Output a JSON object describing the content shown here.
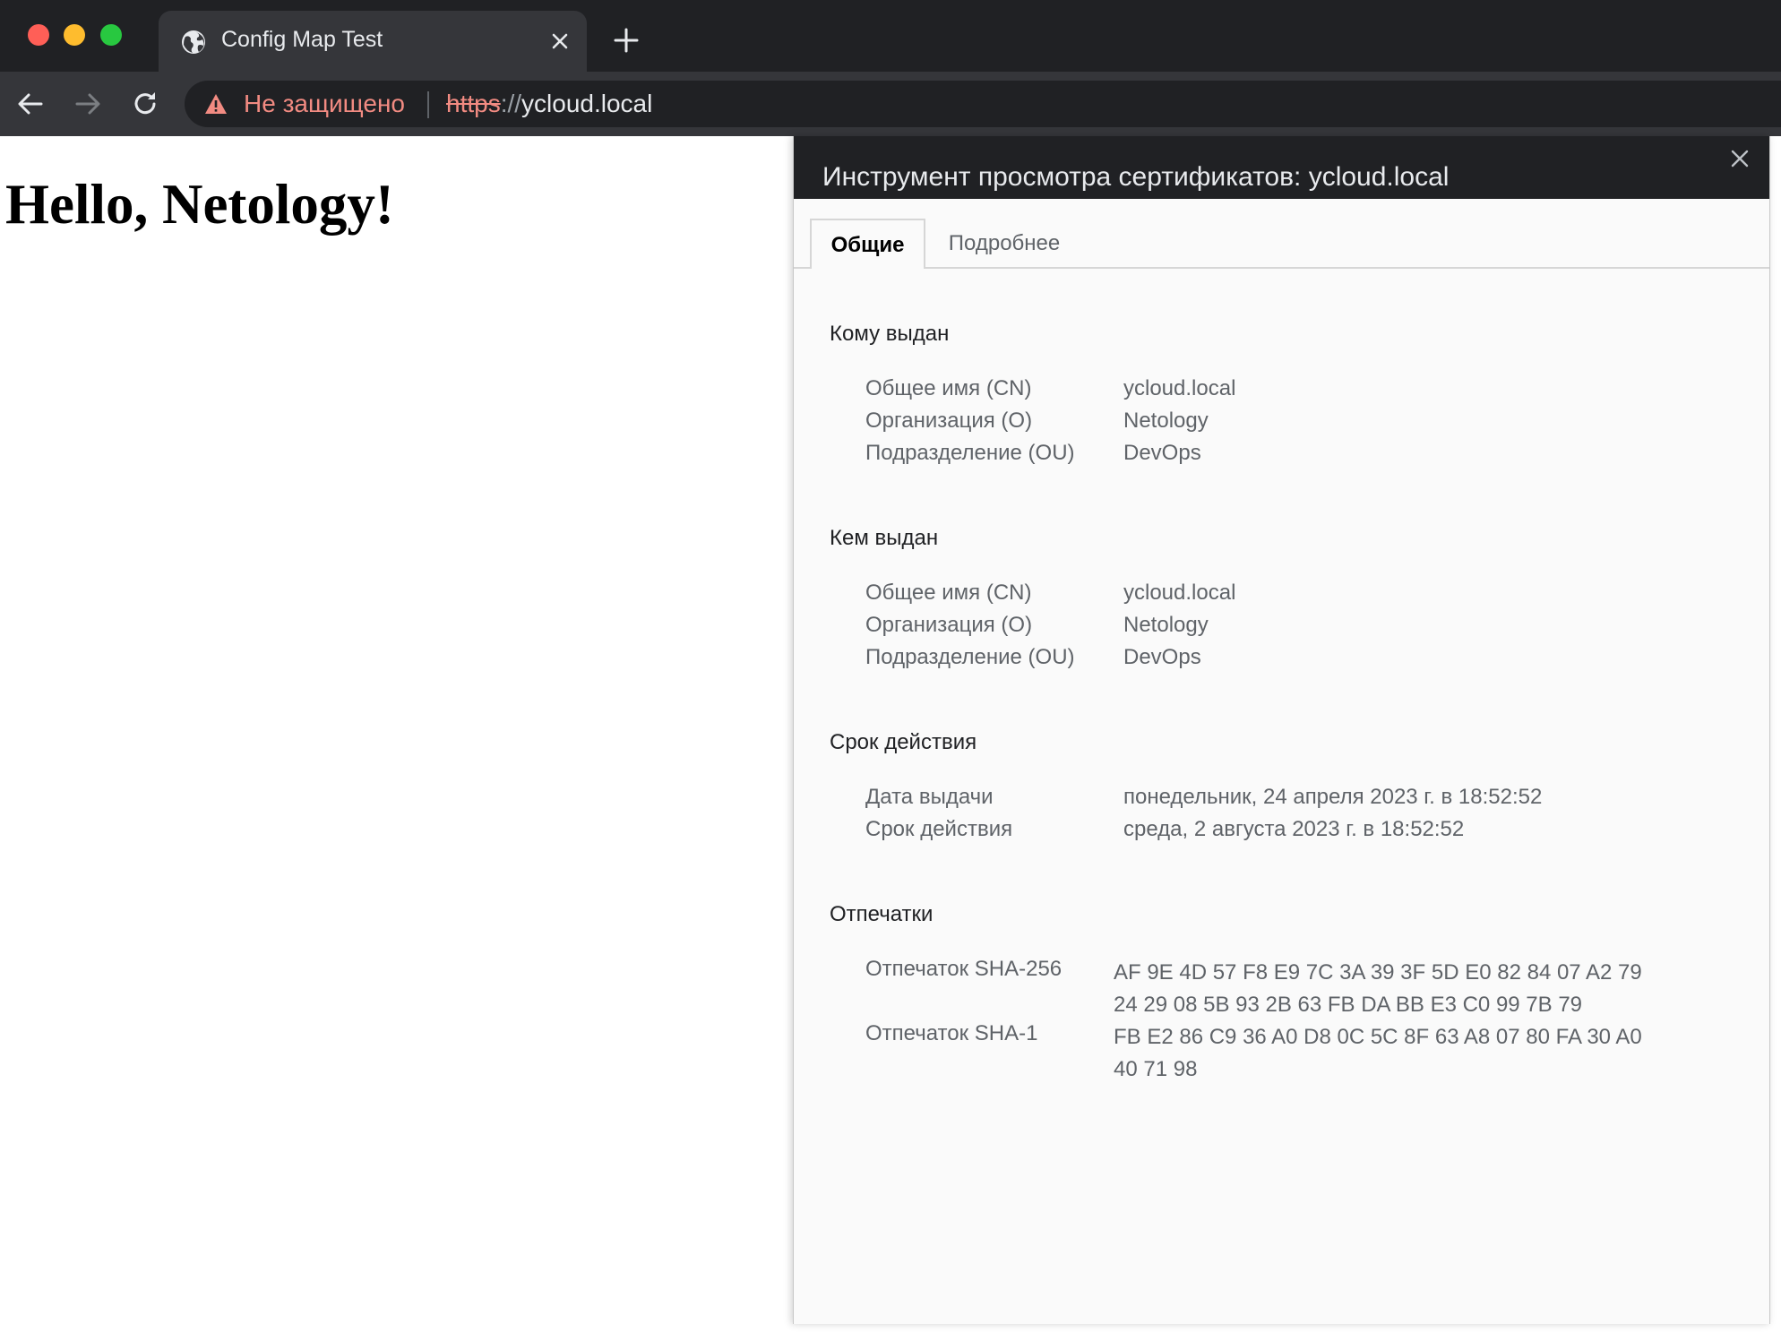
{
  "browser": {
    "tab": {
      "title": "Config Map Test"
    },
    "address_bar": {
      "security_label": "Не защищено",
      "url_scheme": "https",
      "url_separator": "://",
      "url_host": "ycloud.local"
    }
  },
  "page": {
    "heading": "Hello, Netology!"
  },
  "cert_viewer": {
    "title": "Инструмент просмотра сертификатов: ycloud.local",
    "tabs": {
      "general": "Общие",
      "details": "Подробнее"
    },
    "issued_to": {
      "title": "Кому выдан",
      "rows": [
        {
          "label": "Общее имя (CN)",
          "value": "ycloud.local"
        },
        {
          "label": "Организация (O)",
          "value": "Netology"
        },
        {
          "label": "Подразделение (OU)",
          "value": "DevOps"
        }
      ]
    },
    "issued_by": {
      "title": "Кем выдан",
      "rows": [
        {
          "label": "Общее имя (CN)",
          "value": "ycloud.local"
        },
        {
          "label": "Организация (O)",
          "value": "Netology"
        },
        {
          "label": "Подразделение (OU)",
          "value": "DevOps"
        }
      ]
    },
    "validity": {
      "title": "Срок действия",
      "rows": [
        {
          "label": "Дата выдачи",
          "value": "понедельник, 24 апреля 2023 г. в 18:52:52"
        },
        {
          "label": "Срок действия",
          "value": "среда, 2 августа 2023 г. в 18:52:52"
        }
      ]
    },
    "fingerprints": {
      "title": "Отпечатки",
      "rows": [
        {
          "label": "Отпечаток SHA-256",
          "value": "AF 9E 4D 57 F8 E9 7C 3A 39 3F 5D E0 82 84 07 A2 79 24 29 08 5B 93 2B 63 FB DA BB E3 C0 99 7B 79"
        },
        {
          "label": "Отпечаток SHA-1",
          "value": "FB E2 86 C9 36 A0 D8 0C 5C 8F 63 A8 07 80 FA 30 A0 40 71 98"
        }
      ]
    }
  },
  "colors": {
    "chrome_dark": "#202124",
    "chrome_tab": "#35363a",
    "warning_red": "#f28b82",
    "dialog_bg": "#fafafa"
  },
  "icons": {
    "tab_favicon": "globe-icon",
    "tab_close": "close-icon",
    "new_tab": "plus-icon",
    "back": "arrow-left-icon",
    "forward": "arrow-right-icon",
    "reload": "reload-icon",
    "security": "warning-triangle-icon",
    "dialog_close": "close-icon"
  }
}
